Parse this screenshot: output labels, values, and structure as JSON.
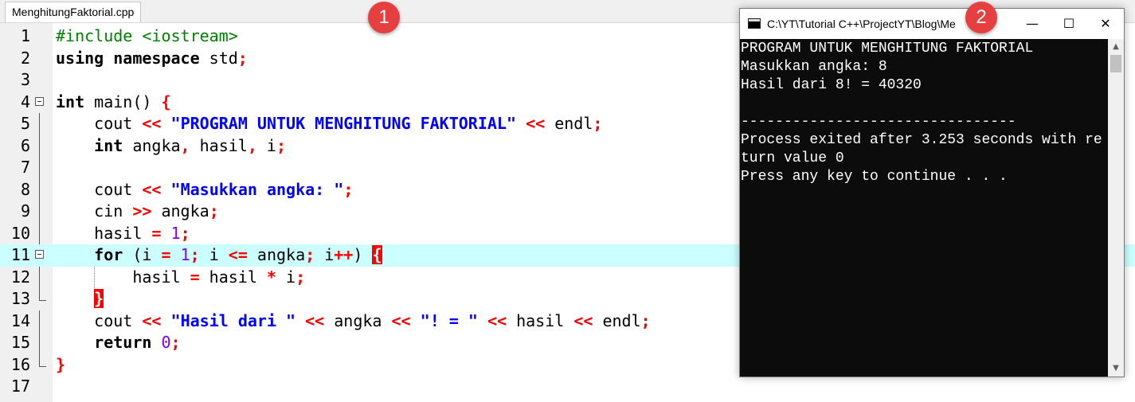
{
  "editor": {
    "tab_label": "MenghitungFaktorial.cpp",
    "line_numbers": [
      "1",
      "2",
      "3",
      "4",
      "5",
      "6",
      "7",
      "8",
      "9",
      "10",
      "11",
      "12",
      "13",
      "14",
      "15",
      "16",
      "17"
    ],
    "code": {
      "l1": "#include <iostream>",
      "l2_kw": "using namespace",
      "l2_rest": " std",
      "l4_kw": "int",
      "l4_rest": " main() ",
      "l5_a": "cout ",
      "l5_str": "\"PROGRAM UNTUK MENGHITUNG FAKTORIAL\"",
      "l5_b": " endl",
      "l6_kw": "int",
      "l6_rest": " angka",
      "l6_b": " hasil",
      "l6_c": " i",
      "l8_a": "cout ",
      "l8_str": "\"Masukkan angka: \"",
      "l9_a": "cin ",
      "l9_b": " angka",
      "l10_a": "hasil ",
      "l10_num": "1",
      "l11_kw": "for",
      "l11_a": " (i ",
      "l11_num": "1",
      "l11_b": " i ",
      "l11_c": " angka",
      "l11_d": " i",
      "l12_a": "hasil ",
      "l12_b": " hasil ",
      "l12_c": " i",
      "l14_a": "cout ",
      "l14_str1": "\"Hasil dari \"",
      "l14_b": " angka ",
      "l14_str2": "\"! = \"",
      "l14_c": " hasil ",
      "l14_d": " endl",
      "l15_kw": "return",
      "l15_num": "0"
    }
  },
  "badges": {
    "one": "1",
    "two": "2"
  },
  "console": {
    "title": "C:\\YT\\Tutorial C++\\ProjectYT\\Blog\\Me",
    "lines": [
      "PROGRAM UNTUK MENGHITUNG FAKTORIAL",
      "Masukkan angka: 8",
      "Hasil dari 8! = 40320",
      "",
      "--------------------------------",
      "Process exited after 3.253 seconds with re",
      "turn value 0",
      "Press any key to continue . . ."
    ]
  },
  "icons": {
    "minimize": "minimize-icon",
    "maximize": "maximize-icon",
    "close": "close-icon"
  },
  "colors": {
    "active_line": "#ccffff",
    "keyword_string": "#0000ff",
    "operator": "#ff0000",
    "preprocessor": "#008000",
    "number": "#8000ff",
    "badge": "#e63f3f",
    "console_bg": "#0c0c0c"
  }
}
